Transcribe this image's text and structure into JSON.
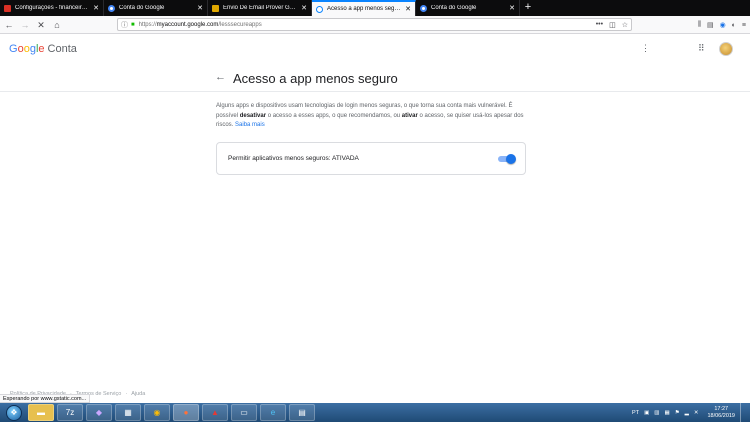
{
  "browser": {
    "tabs": [
      {
        "title": "Configurações - financeiro@..",
        "favicon_color": "#d93025"
      },
      {
        "title": "Conta do Google",
        "favicon_color": "#4285f4"
      },
      {
        "title": "Envio De Email Prover Gmail –",
        "favicon_color": "#e0a800"
      },
      {
        "title": "Acesso a app menos seguro",
        "favicon_color": "#4285f4"
      },
      {
        "title": "Conta do Google",
        "favicon_color": "#4285f4"
      }
    ],
    "active_tab_index": 3,
    "url_prefix": "https://",
    "url_host": "myaccount.google.com",
    "url_path": "/lesssecureapps",
    "status_text": "Esperando por www.gstatic.com..."
  },
  "header": {
    "logo_text": "Google",
    "product_text": "Conta"
  },
  "page": {
    "title": "Acesso a app menos seguro",
    "desc_part1": "Alguns apps e dispositivos usam tecnologias de login menos seguras, o que torna sua conta mais vulnerável. É possível ",
    "desc_bold1": "desativar",
    "desc_part2": " o acesso a esses apps, o que recomendamos, ou ",
    "desc_bold2": "ativar",
    "desc_part3": " o acesso, se quiser usá-los apesar dos riscos. ",
    "learn_more": "Saiba mais",
    "setting_label": "Permitir aplicativos menos seguros: ATIVADA",
    "setting_enabled": true
  },
  "footer": {
    "items": [
      "Política de Privacidade",
      "Termos de Serviço",
      "Ajuda"
    ]
  },
  "taskbar": {
    "lang": "PT",
    "time": "17:27",
    "date": "18/06/2019"
  },
  "colors": {
    "accent": "#1a73e8",
    "google_blue": "#4285f4",
    "google_red": "#ea4335",
    "google_yellow": "#fbbc05",
    "google_green": "#34a853"
  }
}
